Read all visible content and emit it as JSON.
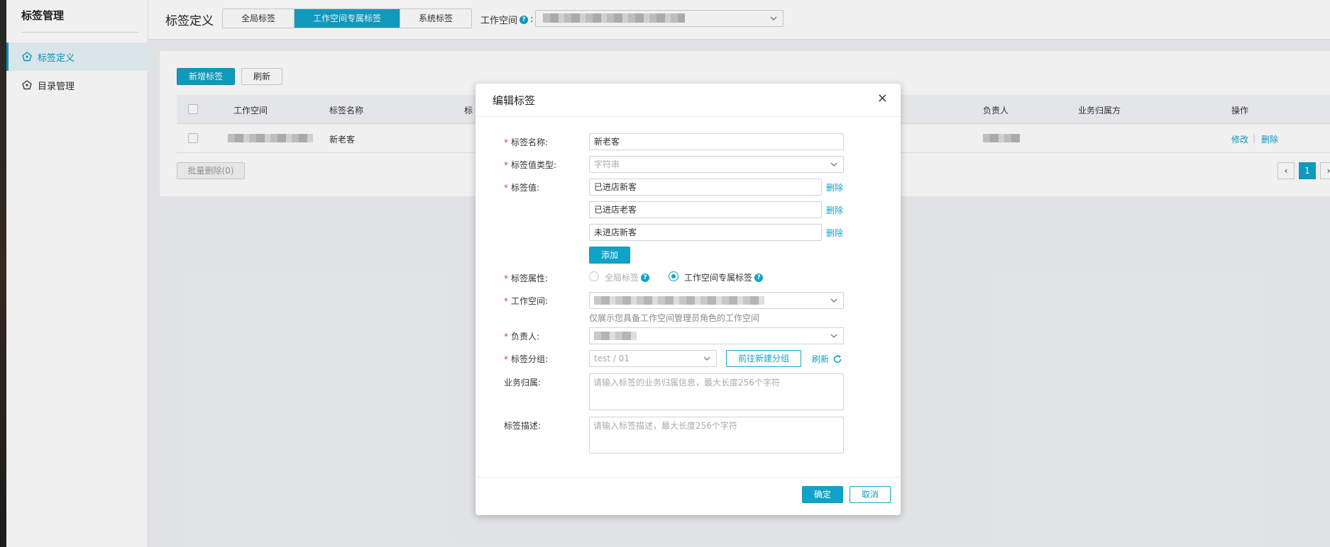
{
  "sidebar": {
    "title": "标签管理",
    "items": [
      {
        "label": "标签定义",
        "icon": "tag-icon",
        "active": true
      },
      {
        "label": "目录管理",
        "icon": "folder-icon",
        "active": false
      }
    ]
  },
  "header": {
    "title": "标签定义",
    "tabs": [
      {
        "label": "全局标签",
        "active": false
      },
      {
        "label": "工作空间专属标签",
        "active": true
      },
      {
        "label": "系统标签",
        "active": false
      }
    ],
    "workspace_label": "工作空间",
    "workspace_colon": ":"
  },
  "toolbar": {
    "add_label": "新增标签",
    "refresh_label": "刷新"
  },
  "table": {
    "columns": [
      "工作空间",
      "标签名称",
      "标",
      "负责人",
      "业务归属方",
      "操作"
    ],
    "rows": [
      {
        "tag_name": "新老客",
        "actions": [
          "修改",
          "删除"
        ]
      }
    ],
    "batch_delete_label": "批量删除(0)",
    "pagination": {
      "current": "1",
      "prev": "‹",
      "next": "›"
    }
  },
  "modal": {
    "title": "编辑标签",
    "close_glyph": "×",
    "fields": {
      "name": {
        "label": "标签名称:",
        "value": "新老客"
      },
      "value_type": {
        "label": "标签值类型:",
        "value": "字符串"
      },
      "values": {
        "label": "标签值:",
        "items": [
          "已进店新客",
          "已进店老客",
          "未进店新客"
        ],
        "delete_label": "删除",
        "add_label": "添加"
      },
      "attribute": {
        "label": "标签属性:",
        "options": [
          {
            "label": "全局标签",
            "selected": false
          },
          {
            "label": "工作空间专属标签",
            "selected": true
          }
        ]
      },
      "workspace": {
        "label": "工作空间:",
        "hint": "仅展示您具备工作空间管理员角色的工作空间"
      },
      "owner": {
        "label": "负责人:"
      },
      "group": {
        "label": "标签分组:",
        "value": "test / 01",
        "goto_label": "前往新建分组",
        "refresh_label": "刷新"
      },
      "business": {
        "label": "业务归属:",
        "placeholder": "请输入标签的业务归属信息，最大长度256个字符"
      },
      "description": {
        "label": "标签描述:",
        "placeholder": "请输入标签描述，最大长度256个字符"
      }
    },
    "required_mark": "*",
    "help_glyph": "?",
    "confirm_label": "确定",
    "cancel_label": "取消"
  },
  "colors": {
    "accent": "#10a3c7",
    "required": "#e0403a"
  }
}
